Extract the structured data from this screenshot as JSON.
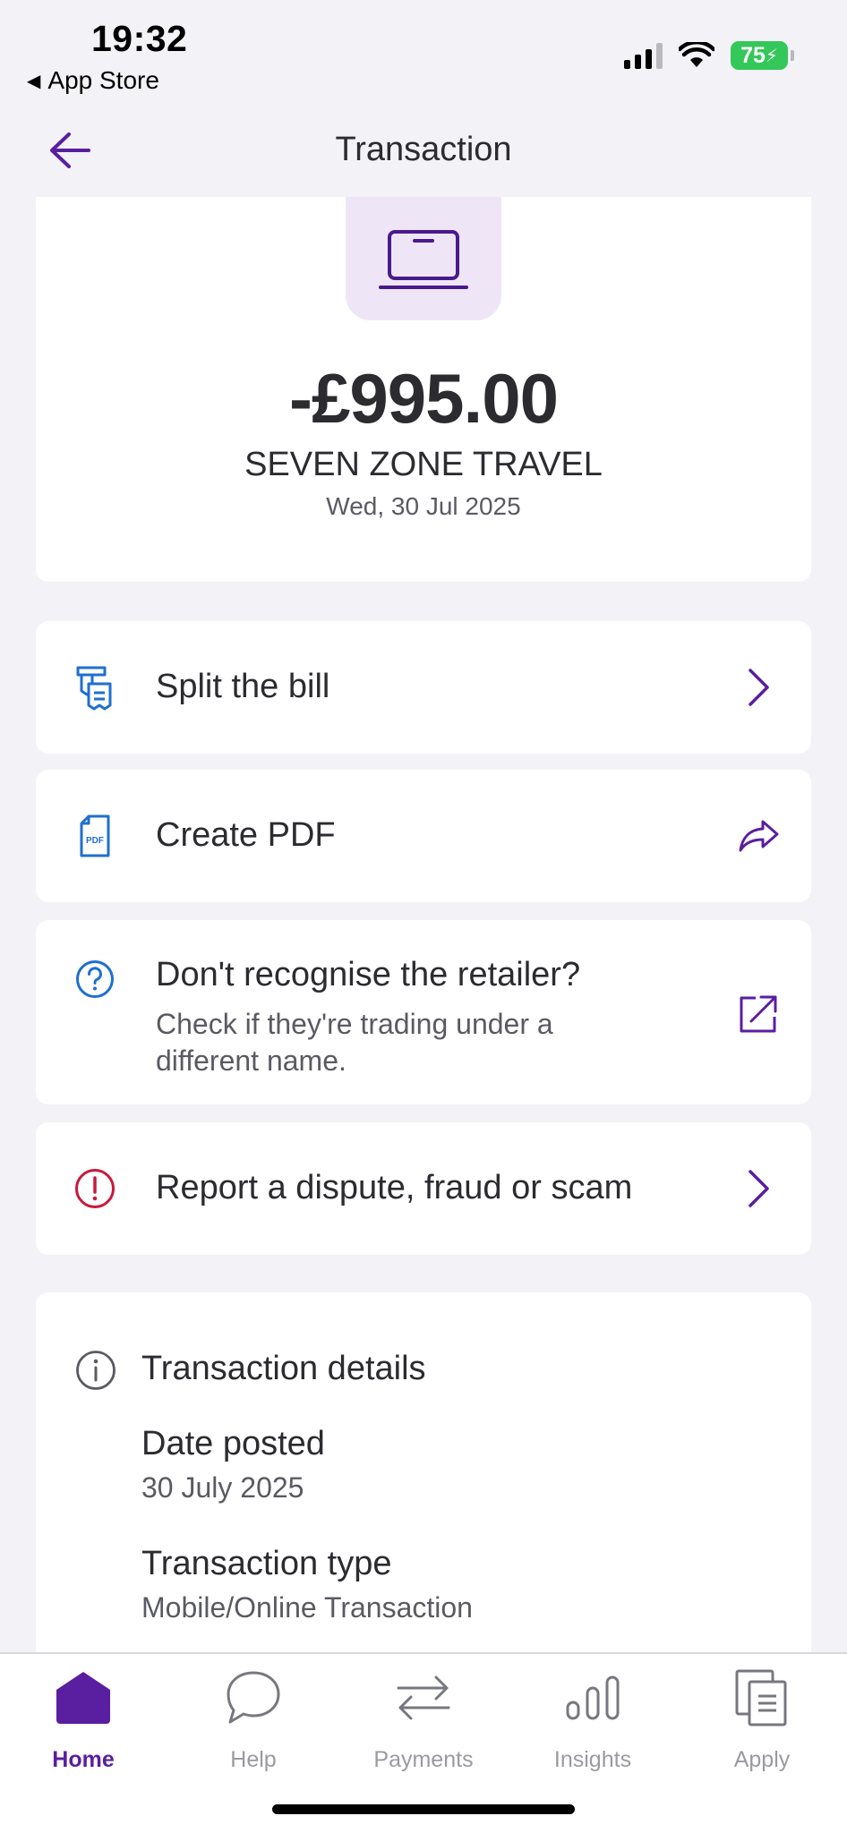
{
  "status_bar": {
    "time": "19:32",
    "back_app": "App Store",
    "battery": "75"
  },
  "header": {
    "title": "Transaction"
  },
  "transaction": {
    "icon": "laptop-icon",
    "amount": "-£995.00",
    "merchant": "SEVEN ZONE TRAVEL",
    "date": "Wed, 30 Jul 2025"
  },
  "actions": {
    "split": {
      "label": "Split the bill",
      "icon": "receipt-split-icon"
    },
    "pdf": {
      "label": "Create PDF",
      "icon": "pdf-file-icon"
    },
    "retailer": {
      "label": "Don't recognise the retailer?",
      "sub_line1": "Check if they're trading under a",
      "sub_line2": "different name.",
      "icon": "question-circle-icon"
    },
    "dispute": {
      "label": "Report a dispute, fraud or scam",
      "icon": "alert-circle-icon"
    }
  },
  "details": {
    "title": "Transaction details",
    "items": [
      {
        "label": "Date posted",
        "value": "30 July 2025"
      },
      {
        "label": "Transaction type",
        "value": "Mobile/Online Transaction"
      }
    ]
  },
  "tabs": [
    {
      "label": "Home",
      "icon": "home-icon",
      "active": true
    },
    {
      "label": "Help",
      "icon": "chat-bubble-icon",
      "active": false
    },
    {
      "label": "Payments",
      "icon": "transfer-arrows-icon",
      "active": false
    },
    {
      "label": "Insights",
      "icon": "bar-chart-icon",
      "active": false
    },
    {
      "label": "Apply",
      "icon": "documents-icon",
      "active": false
    }
  ],
  "colors": {
    "accent": "#5a1ea0",
    "icon_blue": "#1f6fd1",
    "alert_red": "#c8193c",
    "background": "#f3f2f6",
    "hero_icon_bg": "#eee6f7"
  }
}
